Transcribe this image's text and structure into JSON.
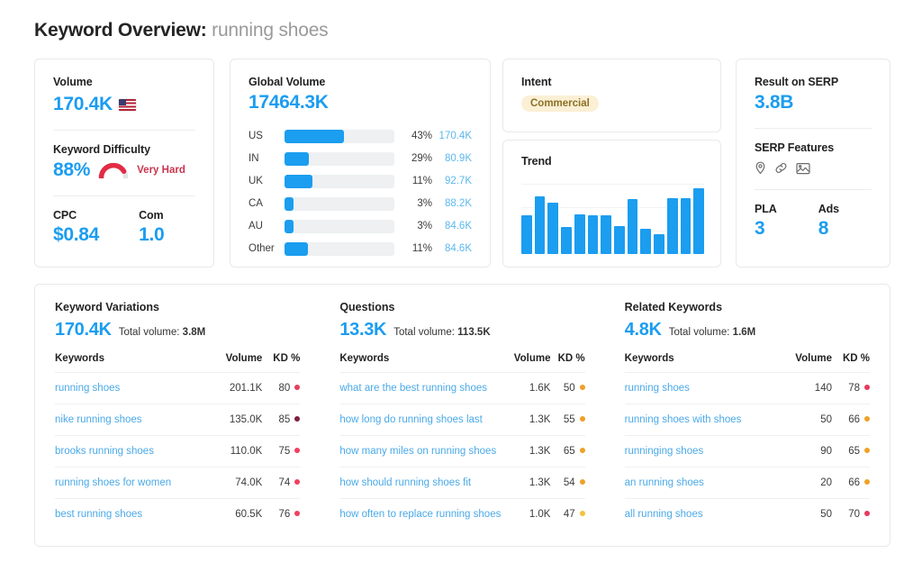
{
  "header": {
    "title_prefix": "Keyword Overview:",
    "keyword": "running shoes"
  },
  "volume_card": {
    "volume_label": "Volume",
    "volume_value": "170.4K",
    "flag_icon": "us-flag-icon",
    "kd_label": "Keyword Difficulty",
    "kd_value": "88%",
    "kd_percent": 88,
    "kd_verdict": "Very Hard",
    "cpc_label": "CPC",
    "cpc_value": "$0.84",
    "com_label": "Com",
    "com_value": "1.0"
  },
  "global_volume_card": {
    "label": "Global Volume",
    "value": "17464.3K",
    "rows": [
      {
        "country": "US",
        "pct": "43%",
        "volume": "170.4K",
        "fill": 54
      },
      {
        "country": "IN",
        "pct": "29%",
        "volume": "80.9K",
        "fill": 22
      },
      {
        "country": "UK",
        "pct": "11%",
        "volume": "92.7K",
        "fill": 25
      },
      {
        "country": "CA",
        "pct": "3%",
        "volume": "88.2K",
        "fill": 8
      },
      {
        "country": "AU",
        "pct": "3%",
        "volume": "84.6K",
        "fill": 8
      },
      {
        "country": "Other",
        "pct": "11%",
        "volume": "84.6K",
        "fill": 21
      }
    ]
  },
  "intent_card": {
    "label": "Intent",
    "badge": "Commercial"
  },
  "trend_card": {
    "label": "Trend"
  },
  "serp_card": {
    "result_label": "Result on SERP",
    "result_value": "3.8B",
    "features_label": "SERP Features",
    "features": [
      "map-pin-icon",
      "link-icon",
      "image-icon"
    ],
    "pla_label": "PLA",
    "pla_value": "3",
    "ads_label": "Ads",
    "ads_value": "8"
  },
  "tables": {
    "columns": [
      {
        "title": "Keyword Variations",
        "count": "170.4K",
        "total_prefix": "Total volume:",
        "total_value": "3.8M",
        "headers": {
          "keyword": "Keywords",
          "volume": "Volume",
          "kd": "KD %"
        },
        "rows": [
          {
            "keyword": "running shoes",
            "volume": "201.1K",
            "kd": "80",
            "dot": "#e63f5c"
          },
          {
            "keyword": "nike running shoes",
            "volume": "135.0K",
            "kd": "85",
            "dot": "#7d2140"
          },
          {
            "keyword": "brooks running shoes",
            "volume": "110.0K",
            "kd": "75",
            "dot": "#ef4060"
          },
          {
            "keyword": "running shoes for women",
            "volume": "74.0K",
            "kd": "74",
            "dot": "#ef4060"
          },
          {
            "keyword": "best running shoes",
            "volume": "60.5K",
            "kd": "76",
            "dot": "#ef4060"
          }
        ]
      },
      {
        "title": "Questions",
        "count": "13.3K",
        "total_prefix": "Total volume:",
        "total_value": "113.5K",
        "headers": {
          "keyword": "Keywords",
          "volume": "Volume",
          "kd": "KD %"
        },
        "rows": [
          {
            "keyword": "what are the best running shoes",
            "volume": "1.6K",
            "kd": "50",
            "dot": "#f0a028"
          },
          {
            "keyword": "how long do running shoes last",
            "volume": "1.3K",
            "kd": "55",
            "dot": "#f0a028"
          },
          {
            "keyword": "how many miles on running shoes",
            "volume": "1.3K",
            "kd": "65",
            "dot": "#efa226"
          },
          {
            "keyword": "how should running shoes fit",
            "volume": "1.3K",
            "kd": "54",
            "dot": "#f0a028"
          },
          {
            "keyword": "how often to replace running shoes",
            "volume": "1.0K",
            "kd": "47",
            "dot": "#f2c23c"
          }
        ]
      },
      {
        "title": "Related Keywords",
        "count": "4.8K",
        "total_prefix": "Total volume:",
        "total_value": "1.6M",
        "headers": {
          "keyword": "Keywords",
          "volume": "Volume",
          "kd": "KD %"
        },
        "rows": [
          {
            "keyword": "running shoes",
            "volume": "140",
            "kd": "78",
            "dot": "#e8395e"
          },
          {
            "keyword": "running shoes with shoes",
            "volume": "50",
            "kd": "66",
            "dot": "#efa226"
          },
          {
            "keyword": "runninging shoes",
            "volume": "90",
            "kd": "65",
            "dot": "#efa226"
          },
          {
            "keyword": "an running shoes",
            "volume": "20",
            "kd": "66",
            "dot": "#efa226"
          },
          {
            "keyword": "all running shoes",
            "volume": "50",
            "kd": "70",
            "dot": "#e8395e"
          }
        ]
      }
    ]
  },
  "chart_data": [
    {
      "type": "bar",
      "title": "Global Volume",
      "orientation": "horizontal",
      "categories": [
        "US",
        "IN",
        "UK",
        "CA",
        "AU",
        "Other"
      ],
      "values": [
        43,
        29,
        11,
        3,
        3,
        11
      ],
      "value_labels": [
        "43%",
        "29%",
        "11%",
        "3%",
        "3%",
        "11%"
      ],
      "secondary_labels": [
        "170.4K",
        "80.9K",
        "92.7K",
        "88.2K",
        "84.6K",
        "84.6K"
      ],
      "xlabel": "",
      "ylabel": "",
      "grid": false,
      "legend": false
    },
    {
      "type": "bar",
      "title": "Trend",
      "categories": [
        "1",
        "2",
        "3",
        "4",
        "5",
        "6",
        "7",
        "8",
        "9",
        "10",
        "11",
        "12",
        "13",
        "14"
      ],
      "values": [
        55,
        82,
        73,
        38,
        57,
        55,
        55,
        40,
        78,
        36,
        28,
        79,
        79,
        93
      ],
      "ylim": [
        0,
        100
      ],
      "xlabel": "",
      "ylabel": "",
      "grid": true,
      "legend": false
    }
  ]
}
